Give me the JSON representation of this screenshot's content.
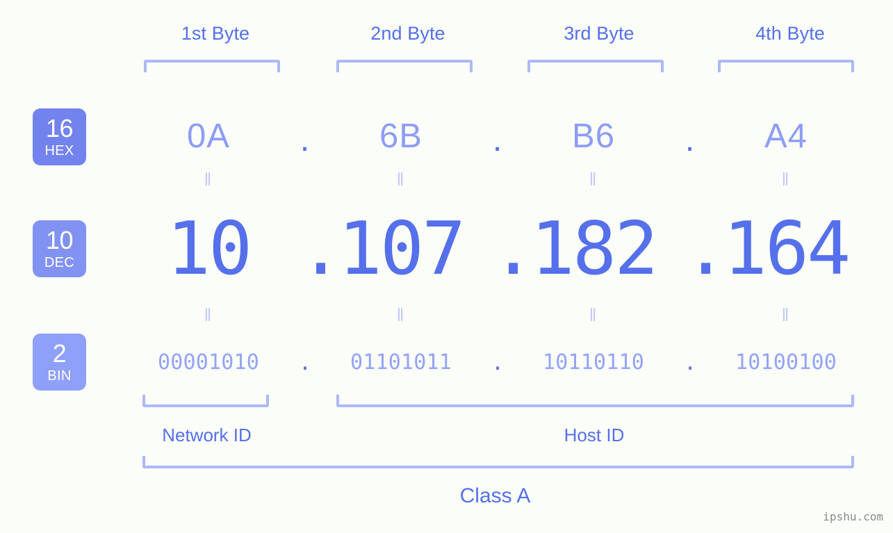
{
  "meta": {
    "background_color": "#fbfdf9",
    "accent_color": "#5570ea",
    "light_accent_color": "#adb8f7",
    "ip_address": "10.107.182.164",
    "watermark": "ipshu.com"
  },
  "byte_headers": [
    {
      "label": "1st Byte"
    },
    {
      "label": "2nd Byte"
    },
    {
      "label": "3rd Byte"
    },
    {
      "label": "4th Byte"
    }
  ],
  "bases": {
    "hex": {
      "number": "16",
      "abbr": "HEX",
      "color": "#7383ee"
    },
    "dec": {
      "number": "10",
      "abbr": "DEC",
      "color": "#8292f2"
    },
    "bin": {
      "number": "2",
      "abbr": "BIN",
      "color": "#8fa0f8"
    }
  },
  "rows": {
    "hex": {
      "values": [
        "0A",
        "6B",
        "B6",
        "A4"
      ],
      "separator": "."
    },
    "dec": {
      "values": [
        "10",
        "107",
        "182",
        "164"
      ],
      "separator": "."
    },
    "bin": {
      "values": [
        "00001010",
        "01101011",
        "10110110",
        "10100100"
      ],
      "separator": "."
    }
  },
  "equals": {
    "symbol": "‖"
  },
  "sections": {
    "network_id": {
      "label": "Network ID"
    },
    "host_id": {
      "label": "Host ID"
    },
    "class": {
      "label": "Class A"
    }
  }
}
